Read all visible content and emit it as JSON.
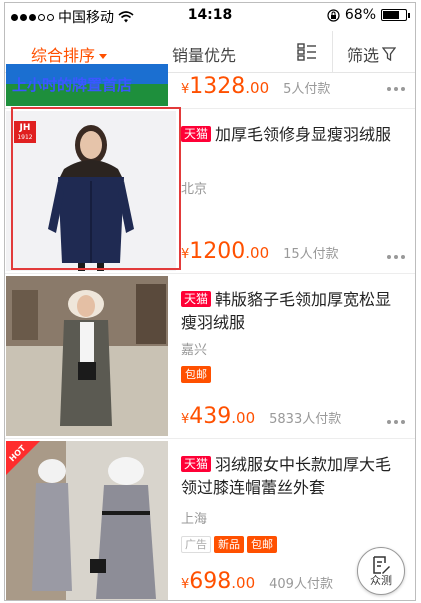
{
  "status_bar": {
    "carrier": "中国移动",
    "time": "14:18",
    "battery_pct": "68%",
    "battery_level": 0.68
  },
  "sort_bar": {
    "tab_overall": "综合排序",
    "tab_sales": "销量优先",
    "grid_icon": "grid-toggle-icon",
    "filter": "筛选",
    "accent_color": "#ff5000"
  },
  "items": [
    {
      "banner_text": "上小时的牌置首店",
      "price_int": "1328",
      "price_dec": ".00",
      "sold": "5人付款"
    },
    {
      "brand_badge": "天猫",
      "logo_text_top": "JH",
      "logo_text_bottom": "1912",
      "title": "加厚毛领修身显瘦羽绒服",
      "location": "北京",
      "price_int": "1200",
      "price_dec": ".00",
      "sold": "15人付款"
    },
    {
      "brand_badge": "天猫",
      "title": "韩版貉子毛领加厚宽松显瘦羽绒服",
      "location": "嘉兴",
      "tag": "包邮",
      "price_int": "439",
      "price_dec": ".00",
      "sold": "5833人付款"
    },
    {
      "brand_badge": "天猫",
      "hot_label": "HOT",
      "title": "羽绒服女中长款加厚大毛领过膝连帽蕾丝外套",
      "location": "上海",
      "tag_ad": "广告",
      "tag_new": "新品",
      "tag_free": "包邮",
      "price_int": "698",
      "price_dec": ".00",
      "sold": "409人付款"
    }
  ],
  "currency": "¥",
  "fab": {
    "label": "众测"
  }
}
